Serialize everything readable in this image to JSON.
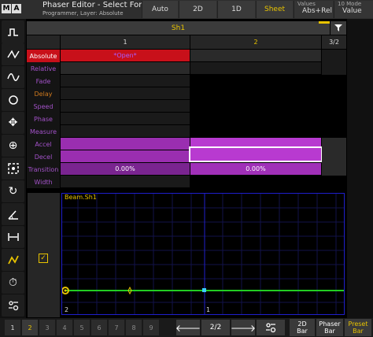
{
  "title": {
    "logo_m": "M",
    "logo_a": "A",
    "main": "Phaser Editor - Select Form",
    "sub": "Programmer, Layer: Absolute"
  },
  "top_buttons": [
    {
      "label": "Auto",
      "active": false
    },
    {
      "label": "2D",
      "active": false
    },
    {
      "label": "1D",
      "active": false
    },
    {
      "label": "Sheet",
      "active": true
    }
  ],
  "values_box": {
    "label": "Values",
    "value": "Abs+Rel"
  },
  "mode_box": {
    "label": "10 Mode",
    "value": "Value"
  },
  "sheet": {
    "header": "Sh1",
    "columns": [
      "1",
      "2",
      "3/2"
    ],
    "rows": [
      {
        "label": "Absolute",
        "cell1": "*Open*",
        "cell2": ""
      },
      {
        "label": "Relative",
        "cell1": "",
        "cell2": ""
      },
      {
        "label": "Fade",
        "cell1": "",
        "cell2": ""
      },
      {
        "label": "Delay",
        "cell1": "",
        "cell2": ""
      },
      {
        "label": "Speed",
        "cell1": "",
        "cell2": ""
      },
      {
        "label": "Phase",
        "cell1": "",
        "cell2": ""
      },
      {
        "label": "Measure",
        "cell1": "",
        "cell2": ""
      },
      {
        "label": "Accel",
        "cell1": "",
        "cell2": ""
      },
      {
        "label": "Decel",
        "cell1": "",
        "cell2": ""
      },
      {
        "label": "Transition",
        "cell1": "0.00%",
        "cell2": "0.00%"
      },
      {
        "label": "Width",
        "cell1": "",
        "cell2": ""
      }
    ]
  },
  "graph": {
    "title": "Beam.Sh1",
    "label_left": "2",
    "label_mid": "1"
  },
  "pages": [
    "1",
    "2",
    "3",
    "4",
    "5",
    "6",
    "7",
    "8",
    "9"
  ],
  "page_indicator": "2/2",
  "bottom_modes": [
    {
      "label": "2D Bar",
      "l1": "2D",
      "l2": "Bar",
      "active": false
    },
    {
      "label": "Phaser Bar",
      "l1": "Phaser",
      "l2": "Bar",
      "active": false
    },
    {
      "label": "Preset Bar",
      "l1": "Preset",
      "l2": "Bar",
      "active": true
    }
  ],
  "colors": {
    "accent": "#e8c300",
    "selected_row": "#c8101a",
    "purple_cell": "#a030b8",
    "graph_line": "#22cc22",
    "graph_border": "#1f1fcc"
  }
}
